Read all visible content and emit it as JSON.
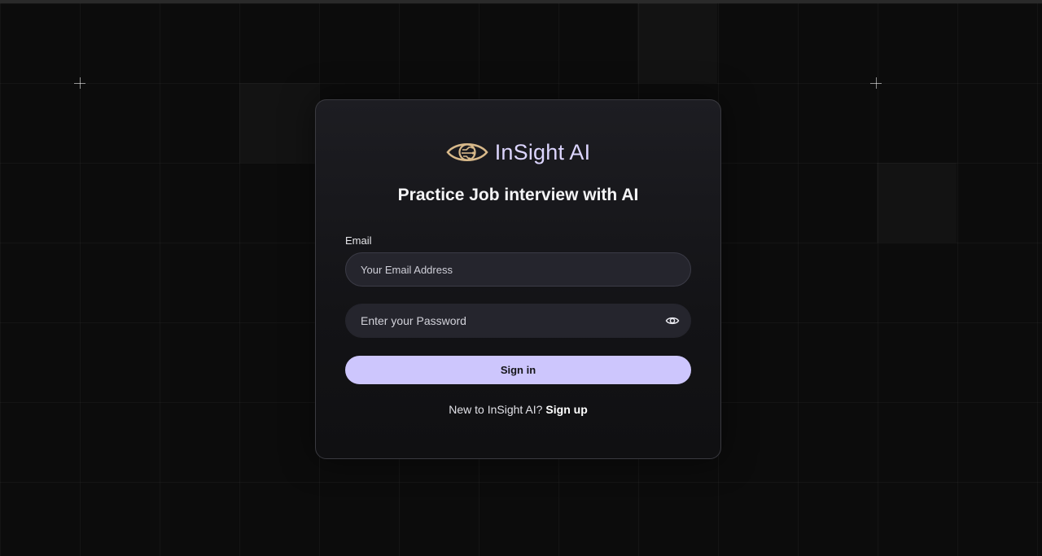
{
  "brand": {
    "name": "InSight AI",
    "logo_icon": "eye-circuit-icon",
    "logo_color": "#d8b98a"
  },
  "headline": "Practice Job interview with AI",
  "form": {
    "email_label": "Email",
    "email_placeholder": "Your Email Address",
    "password_placeholder": "Enter your Password",
    "password_toggle_icon": "eye-icon",
    "submit_label": "Sign in"
  },
  "footer": {
    "prompt": "New to InSight AI?",
    "link_label": "Sign up"
  },
  "colors": {
    "background": "#0c0c0c",
    "card": "#16161a",
    "accent": "#cdc6fd",
    "input_bg": "#25252d"
  }
}
